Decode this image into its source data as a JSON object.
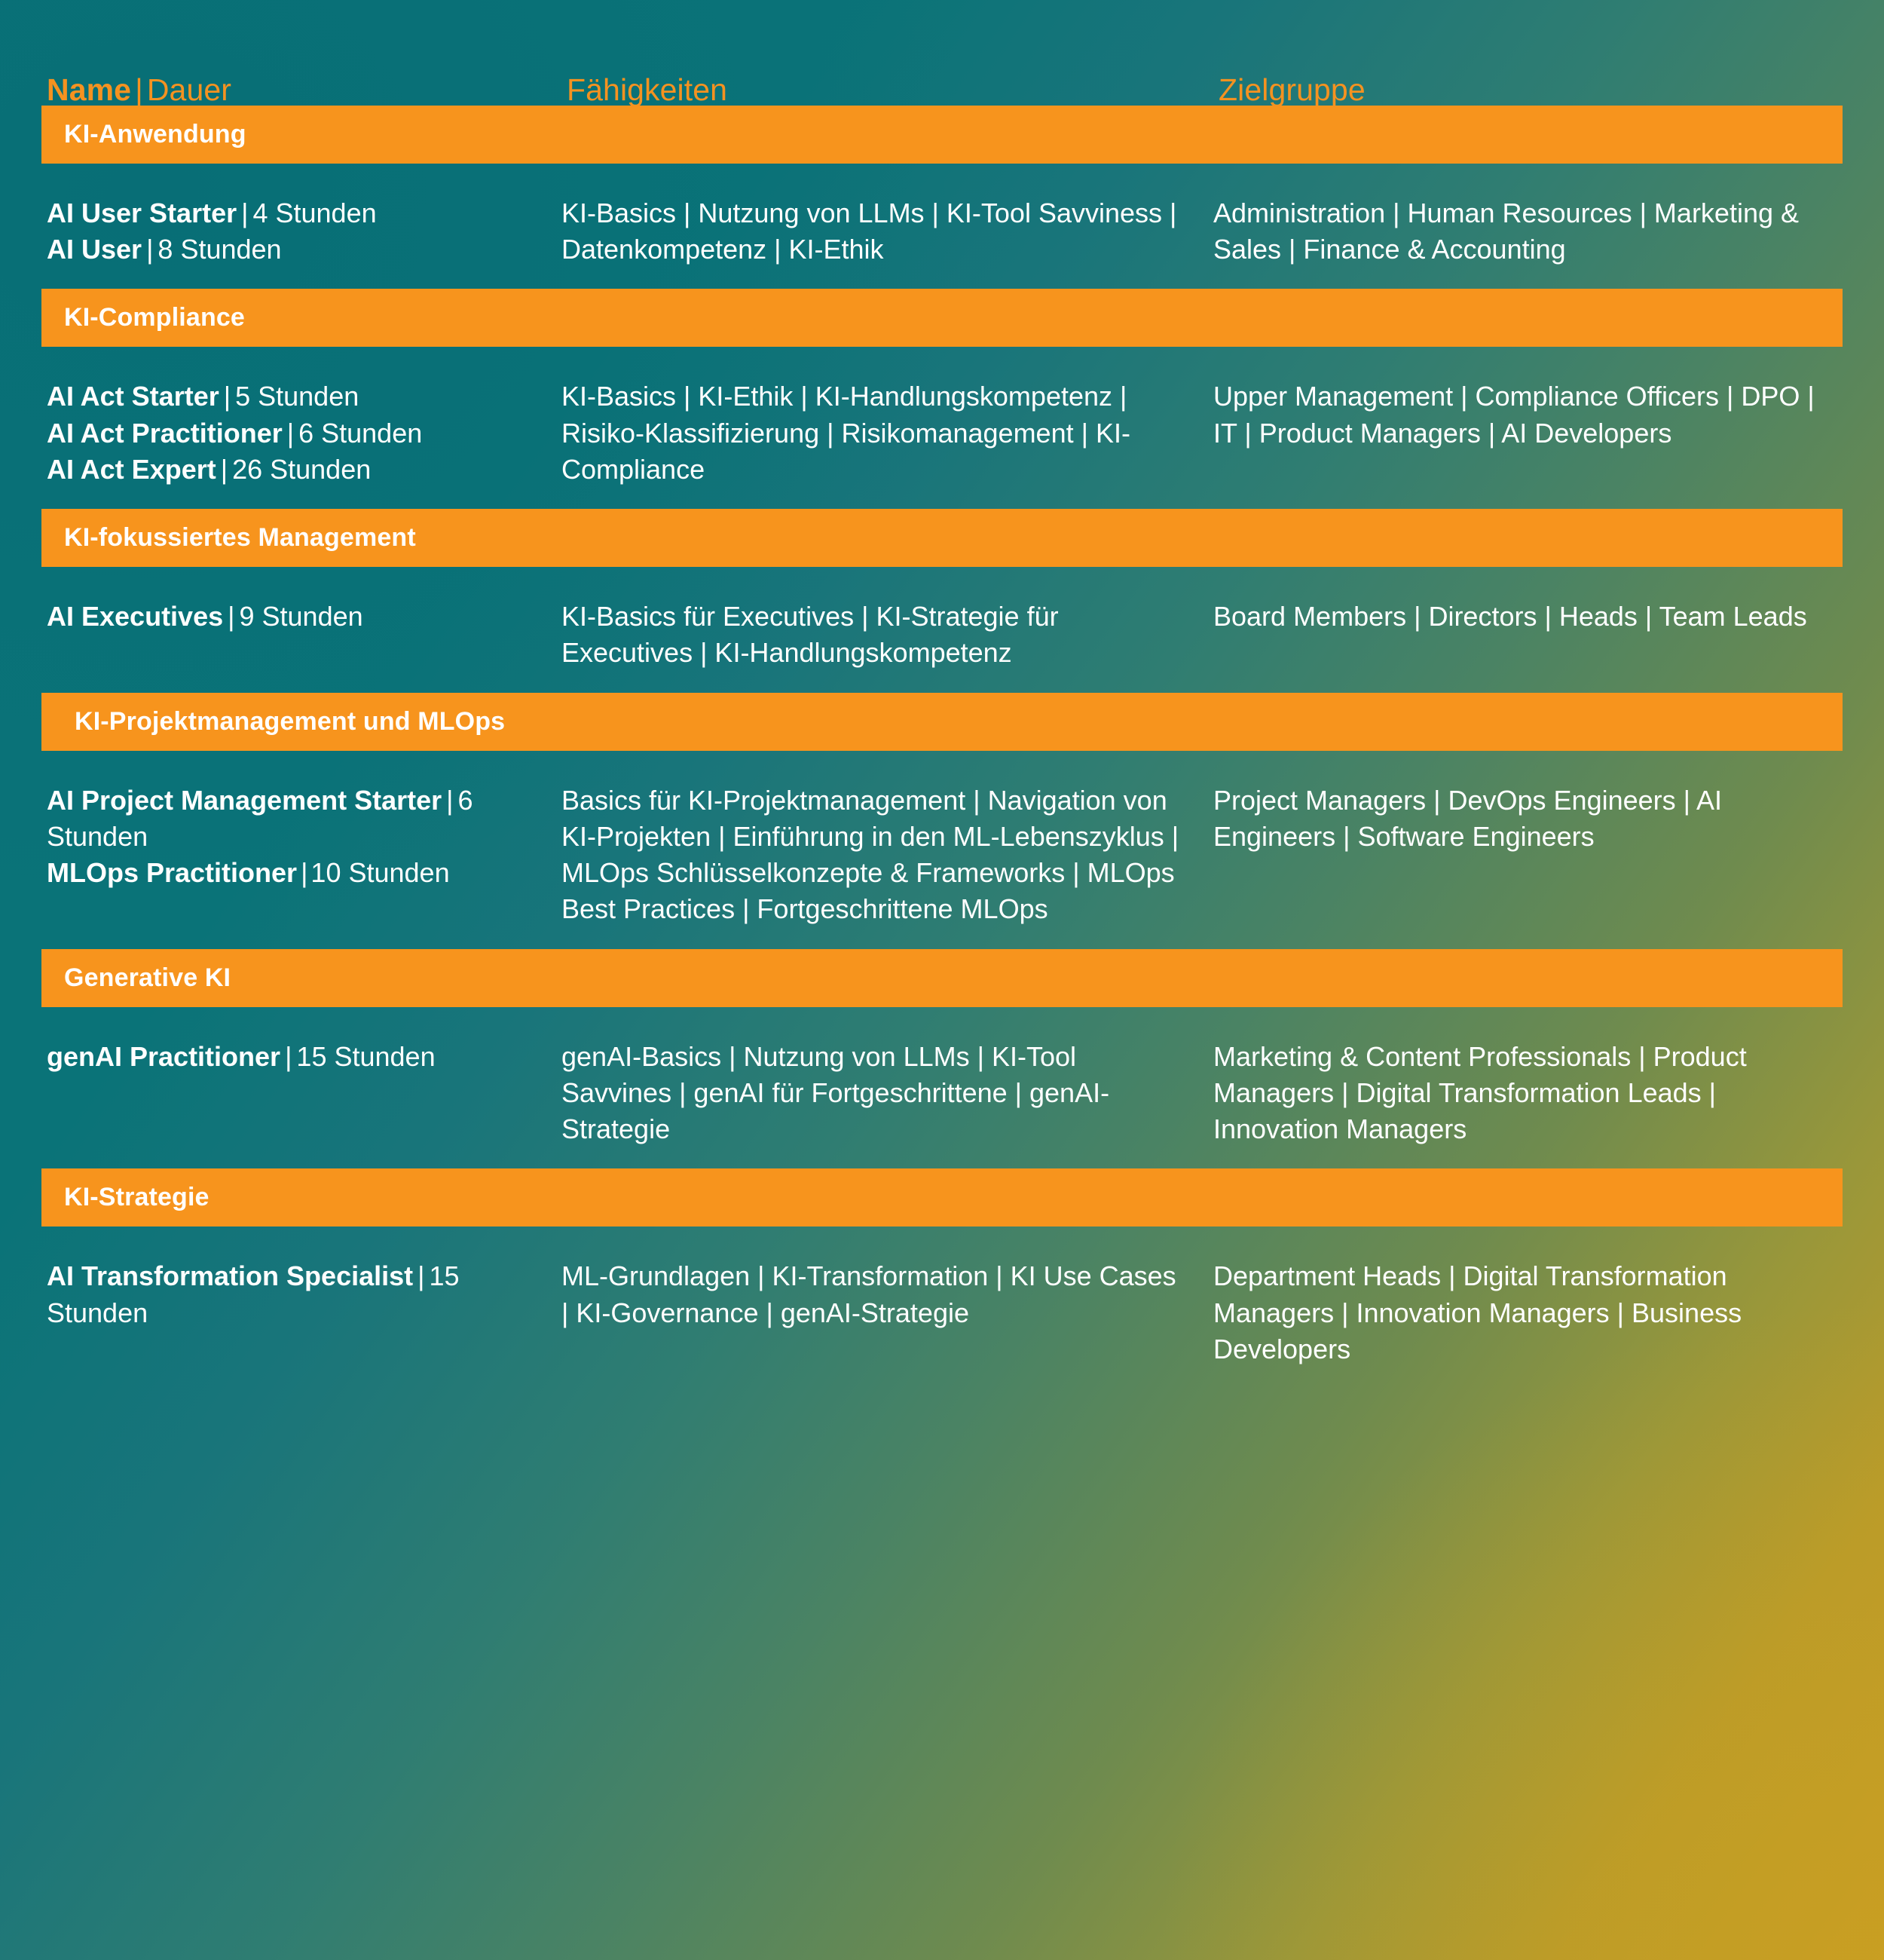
{
  "columns": {
    "name_strong": "Name",
    "name_sep": "|",
    "name_rest": "Dauer",
    "skills": "Fähigkeiten",
    "target": "Zielgruppe"
  },
  "colors": {
    "accent_orange": "#f7941d",
    "header_orange": "#f59220",
    "teal": "#0a7378",
    "gold": "#c49d27",
    "text_white": "#ffffff"
  },
  "sections": [
    {
      "title": "KI-Anwendung",
      "pad": "a",
      "courses": [
        {
          "name": "AI User Starter",
          "sep": "|",
          "duration": "4 Stunden"
        },
        {
          "name": "AI User",
          "sep": "|",
          "duration": "8 Stunden"
        }
      ],
      "skills": "KI-Basics | Nutzung von LLMs | KI-Tool Savviness | Datenkompetenz | KI-Ethik",
      "target": "Administration | Human Resources | Marketing & Sales | Finance & Accounting"
    },
    {
      "title": "KI-Compliance",
      "pad": "a",
      "courses": [
        {
          "name": "AI Act Starter",
          "sep": "|",
          "duration": "5 Stunden"
        },
        {
          "name": "AI Act Practitioner",
          "sep": "|",
          "duration": "6 Stunden"
        },
        {
          "name": "AI Act Expert",
          "sep": "|",
          "duration": "26 Stunden"
        }
      ],
      "skills": "KI-Basics | KI-Ethik | KI-Handlungskompetenz | Risiko-Klassifizierung | Risikomanagement | KI-Compliance",
      "target": "Upper Management | Compliance Officers | DPO | IT | Product Managers | AI Developers"
    },
    {
      "title": "KI-fokussiertes Management",
      "pad": "a",
      "courses": [
        {
          "name": "AI Executives",
          "sep": "|",
          "duration": "9 Stunden"
        }
      ],
      "skills": "KI-Basics für Executives | KI-Strategie für Executives | KI-Handlungskompetenz",
      "target": "Board Members | Directors | Heads | Team Leads"
    },
    {
      "title": "KI-Projektmanagement und MLOps",
      "pad": "b",
      "wrap_name": true,
      "courses": [
        {
          "name": "AI Project Management Starter",
          "sep": "|",
          "duration": "6 Stunden"
        },
        {
          "name": "MLOps Practitioner",
          "sep": "|",
          "duration": "10 Stunden",
          "tight": true
        }
      ],
      "skills": "Basics für KI-Projektmanagement | Navigation von KI-Projekten | Einführung in den ML-Lebenszyklus | MLOps Schlüsselkonzepte & Frameworks | MLOps Best Practices | Fortgeschrittene MLOps",
      "target": "Project Managers | DevOps Engineers | AI Engineers | Software Engineers"
    },
    {
      "title": "Generative KI",
      "pad": "a",
      "courses": [
        {
          "name": "genAI Practitioner",
          "sep": "|",
          "duration": "15 Stunden"
        }
      ],
      "skills": "genAI-Basics | Nutzung von LLMs | KI-Tool Savvines | genAI für Fortgeschrittene | genAI-Strategie",
      "target": "Marketing & Content Professionals | Product Managers | Digital Transformation Leads | Innovation Managers"
    },
    {
      "title": "KI-Strategie",
      "pad": "a",
      "wrap_name": true,
      "courses": [
        {
          "name": "AI Transformation Specialist",
          "sep": "|",
          "duration": "15 Stunden"
        }
      ],
      "skills": "ML-Grundlagen | KI-Transformation | KI Use Cases | KI-Governance | genAI-Strategie",
      "target": "Department Heads | Digital Transformation Managers | Innovation Managers | Business Developers"
    }
  ]
}
